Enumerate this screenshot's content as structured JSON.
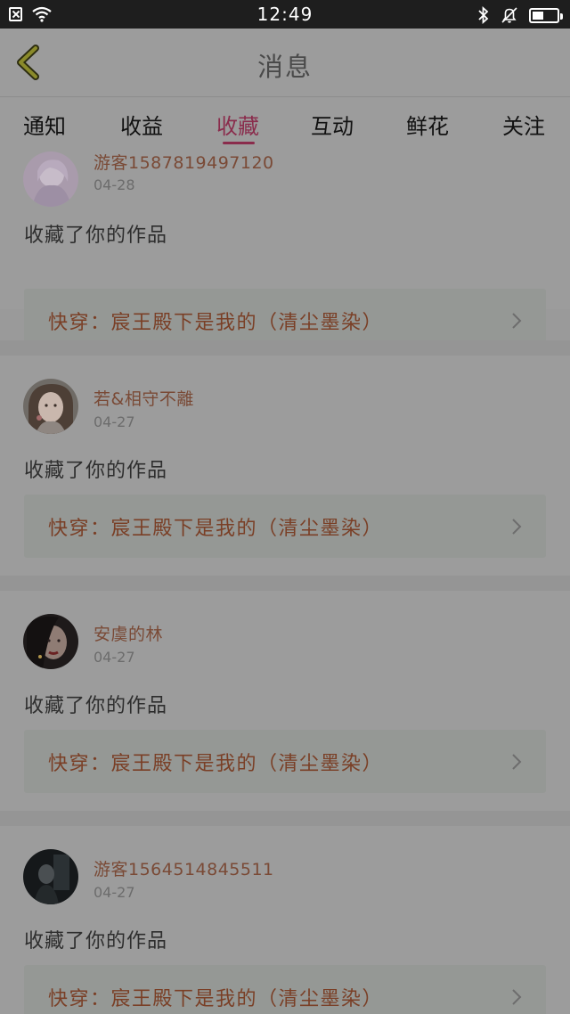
{
  "status_bar": {
    "time": "12:49",
    "icons": [
      "sim-off-icon",
      "wifi-icon",
      "bluetooth-icon",
      "mute-bell-icon",
      "battery-icon"
    ],
    "battery_level": 0.45
  },
  "header": {
    "title": "消息",
    "back_icon": "chevron-left-icon"
  },
  "tabs": [
    {
      "label": "通知"
    },
    {
      "label": "收益"
    },
    {
      "label": "收藏"
    },
    {
      "label": "互动"
    },
    {
      "label": "鲜花"
    },
    {
      "label": "关注"
    }
  ],
  "active_tab": "收藏",
  "colors": {
    "accent": "#8a2c4c",
    "username": "#7a4a36",
    "work_title": "#7a3f26"
  },
  "messages": [
    {
      "username": "游客1587819497120",
      "date": "04-28",
      "action": "收藏了你的作品",
      "work_title": "快穿：宸王殿下是我的（清尘墨染）"
    },
    {
      "username": "若&相守不離",
      "date": "04-27",
      "action": "收藏了你的作品",
      "work_title": "快穿：宸王殿下是我的（清尘墨染）"
    },
    {
      "username": "安虞的林",
      "date": "04-27",
      "action": "收藏了你的作品",
      "work_title": "快穿：宸王殿下是我的（清尘墨染）"
    },
    {
      "username": "游客1564514845511",
      "date": "04-27",
      "action": "收藏了你的作品",
      "work_title": "快穿：宸王殿下是我的（清尘墨染）"
    }
  ]
}
